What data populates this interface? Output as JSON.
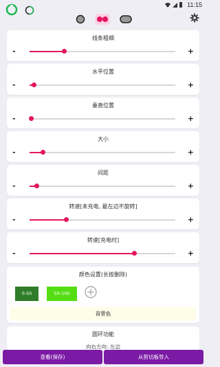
{
  "status_bar": {
    "time": "11:15"
  },
  "header": {
    "modes": [
      "dot-mode",
      "double-dot-mode",
      "capsule-mode"
    ],
    "selected_mode": 1
  },
  "sliders": [
    {
      "label": "线条粗细",
      "minus": "-",
      "plus": "+",
      "value": 0.24
    },
    {
      "label": "水平位置",
      "minus": "-",
      "plus": "+",
      "value": 0.03
    },
    {
      "label": "垂直位置",
      "minus": "-",
      "plus": "+",
      "value": 0.01
    },
    {
      "label": "大小",
      "minus": "-",
      "plus": "+",
      "value": 0.09
    },
    {
      "label": "间距",
      "minus": "-",
      "plus": "+",
      "value": 0.05
    },
    {
      "label": "转速[未充电, 最左边不旋转]",
      "minus": "-",
      "plus": "+",
      "value": 0.25
    },
    {
      "label": "转速[充电时]",
      "minus": "-",
      "plus": "+",
      "value": 0.72
    }
  ],
  "color_settings": {
    "title": "颜色设置(长按删除)",
    "swatches": [
      {
        "label": "0-50",
        "color": "#2f7d2a"
      },
      {
        "label": "50-100",
        "color": "#55dd14"
      }
    ],
    "background_label": "背景色"
  },
  "loop_function": {
    "title": "圆环功能",
    "subtitle": "向右方向: 左边"
  },
  "footer": {
    "view_save": "查看(保存)",
    "import_clipboard": "从剪切板导入"
  },
  "colors": {
    "accent": "#e5155f",
    "button": "#7b1aa5",
    "background": "#efeef4"
  }
}
